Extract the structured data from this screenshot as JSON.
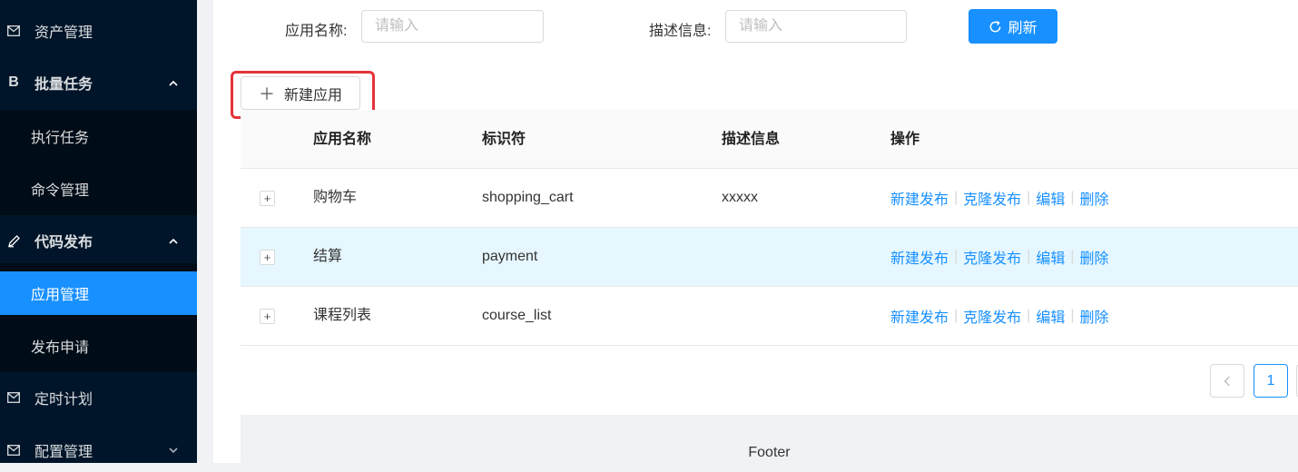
{
  "sidebar": {
    "items": [
      {
        "label": "资产管理",
        "icon": "mail-icon"
      },
      {
        "label": "批量任务",
        "icon": "letter-b-icon",
        "icon_text": "B",
        "expanded": true,
        "children": [
          {
            "label": "执行任务"
          },
          {
            "label": "命令管理"
          }
        ]
      },
      {
        "label": "代码发布",
        "icon": "edit-icon",
        "expanded": true,
        "children": [
          {
            "label": "应用管理",
            "active": true
          },
          {
            "label": "发布申请"
          }
        ]
      },
      {
        "label": "定时计划",
        "icon": "mail-icon"
      },
      {
        "label": "配置管理",
        "icon": "mail-icon",
        "expanded": false
      }
    ]
  },
  "search": {
    "name_label": "应用名称:",
    "name_placeholder": "请输入",
    "name_value": "",
    "desc_label": "描述信息:",
    "desc_placeholder": "请输入",
    "desc_value": "",
    "refresh_label": "刷新"
  },
  "new_app_label": "新建应用",
  "table": {
    "columns": [
      "应用名称",
      "标识符",
      "描述信息",
      "操作"
    ],
    "rows": [
      {
        "name": "购物车",
        "identifier": "shopping_cart",
        "description": "xxxxx"
      },
      {
        "name": "结算",
        "identifier": "payment",
        "description": ""
      },
      {
        "name": "课程列表",
        "identifier": "course_list",
        "description": ""
      }
    ],
    "actions": [
      "新建发布",
      "克隆发布",
      "编辑",
      "删除"
    ]
  },
  "pagination": {
    "current": "1"
  },
  "footer": "Footer",
  "colors": {
    "primary": "#1890ff",
    "sider": "#001529",
    "submenu": "#000c17",
    "highlight": "#e5333a"
  }
}
